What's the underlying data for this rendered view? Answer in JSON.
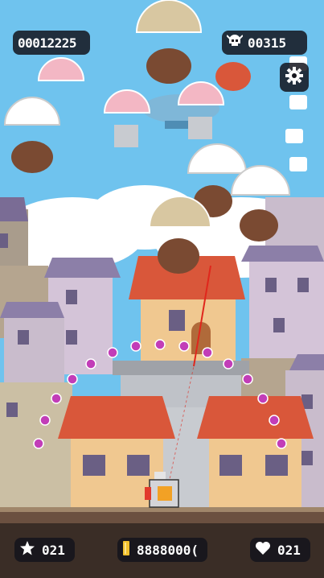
{
  "hud": {
    "score": "00012225",
    "kills": "00315",
    "stars": "021",
    "coins": "8888000(",
    "lives": "021"
  },
  "icons": {
    "settings": "gear-icon",
    "kills": "skull-icon",
    "stars": "star-icon",
    "coins": "coin-icon",
    "lives": "heart-icon"
  },
  "colors": {
    "sky": "#6fc3ee",
    "hud_bg": "#14141c",
    "roof": "#d9573a",
    "orb": "#c23db8",
    "laser": "#e0261c",
    "ground": "#3a2d26"
  }
}
